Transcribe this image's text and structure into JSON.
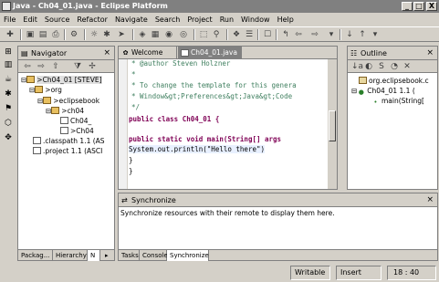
{
  "window": {
    "title": "Java - Ch04_01.java - Eclipse Platform",
    "minimize": "_",
    "maximize": "□",
    "close": "X"
  },
  "menu": [
    "File",
    "Edit",
    "Source",
    "Refactor",
    "Navigate",
    "Search",
    "Project",
    "Run",
    "Window",
    "Help"
  ],
  "navigator": {
    "title": "Navigator",
    "tree": [
      ">Ch04_01  [STEVE]",
      ">org",
      ">eclipsebook",
      ">ch04",
      "Ch04_",
      ">Ch04",
      ".classpath  1.1  (AS",
      ".project  1.1  (ASCI"
    ],
    "tabs": [
      "Packag...",
      "Hierarchy",
      "N"
    ]
  },
  "editor": {
    "tabs": [
      "Welcome",
      "Ch04_01.java"
    ],
    "lines": [
      " * @author Steven Holzner",
      " *",
      " * To change the template for this genera",
      " * Window&gt;Preferences&gt;Java&gt;Code",
      " */",
      "public class Ch04_01 {",
      "",
      "    public static void main(String[] args",
      "        System.out.println(\"Hello there\")",
      "    }",
      "}"
    ]
  },
  "outline": {
    "title": "Outline",
    "tree": [
      "org.eclipsebook.c",
      "Ch04_01  1.1  (",
      "main(String["
    ]
  },
  "synchronize": {
    "title": "Synchronize",
    "message": "Synchronize resources with their remote to display them here.",
    "tabs": [
      "Tasks",
      "Console",
      "Synchronize"
    ]
  },
  "status": {
    "mode": "Writable",
    "insert": "Insert",
    "position": "18 : 40"
  },
  "colors": {
    "comment": "#3f7f5f",
    "keyword": "#7f0055",
    "string": "#2a00ff"
  }
}
